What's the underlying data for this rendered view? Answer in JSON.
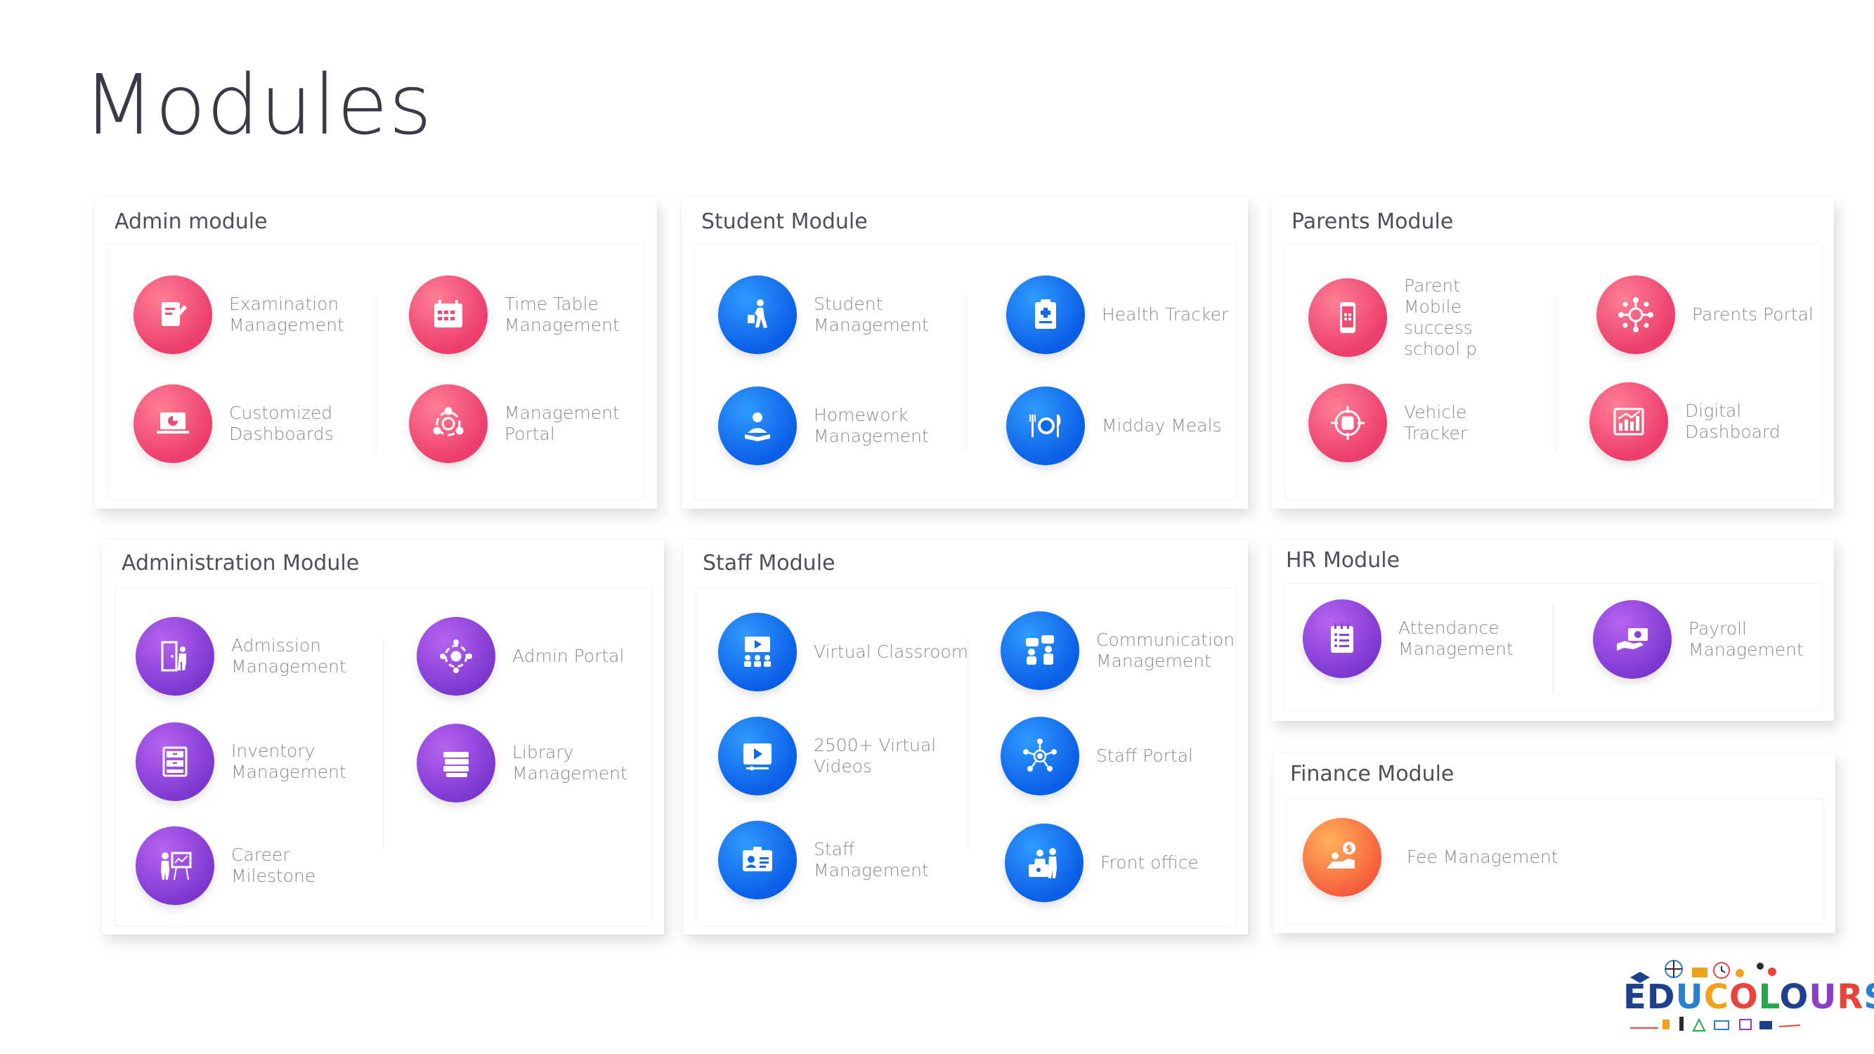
{
  "page": {
    "title": "Modules"
  },
  "modules": {
    "admin": {
      "title": "Admin module",
      "items": [
        {
          "label": "Examination\nManagement",
          "icon": "exam-edit-icon"
        },
        {
          "label": "Time Table\nManagement",
          "icon": "calendar-icon"
        },
        {
          "label": "Customized\nDashboards",
          "icon": "laptop-chart-icon"
        },
        {
          "label": "Management\nPortal",
          "icon": "network-globe-icon"
        }
      ]
    },
    "student": {
      "title": "Student Module",
      "items": [
        {
          "label": "Student\nManagement",
          "icon": "student-walking-icon"
        },
        {
          "label": "Health Tracker",
          "icon": "clipboard-medical-icon"
        },
        {
          "label": "Homework\nManagement",
          "icon": "reading-person-icon"
        },
        {
          "label": "Midday Meals",
          "icon": "plate-cutlery-icon"
        }
      ]
    },
    "parents": {
      "title": "Parents  Module",
      "items": [
        {
          "label": "Parent\nMobile\nsuccess\nschool p",
          "icon": "mobile-phone-icon"
        },
        {
          "label": "Parents Portal",
          "icon": "family-network-icon"
        },
        {
          "label": "Vehicle\nTracker",
          "icon": "bus-target-icon"
        },
        {
          "label": "Digital\nDashboard",
          "icon": "bar-chart-icon"
        }
      ]
    },
    "administration": {
      "title": "Administration Module",
      "items": [
        {
          "label": "Admission\nManagement",
          "icon": "door-entry-icon"
        },
        {
          "label": "Admin Portal",
          "icon": "admin-network-icon"
        },
        {
          "label": "Inventory\nManagement",
          "icon": "cabinet-icon"
        },
        {
          "label": "Library\nManagement",
          "icon": "books-stack-icon"
        },
        {
          "label": "Career\nMilestone",
          "icon": "presentation-icon"
        }
      ]
    },
    "staff": {
      "title": "Staff Module",
      "items": [
        {
          "label": "Virtual Classroom",
          "icon": "video-class-icon"
        },
        {
          "label": "Communication\nManagement",
          "icon": "chat-people-icon"
        },
        {
          "label": "2500+ Virtual\nVideos",
          "icon": "play-screen-icon"
        },
        {
          "label": "Staff Portal",
          "icon": "hub-network-icon"
        },
        {
          "label": "Staff\nManagement",
          "icon": "id-card-icon"
        },
        {
          "label": "Front office",
          "icon": "reception-desk-icon"
        }
      ]
    },
    "hr": {
      "title": "HR Module",
      "items": [
        {
          "label": "Attendance\nManagement",
          "icon": "notepad-list-icon"
        },
        {
          "label": "Payroll\nManagement",
          "icon": "hand-money-icon"
        }
      ]
    },
    "finance": {
      "title": "Finance Module",
      "items": [
        {
          "label": "Fee Management",
          "icon": "fee-coins-icon"
        }
      ]
    }
  },
  "brand": {
    "name": "EDUCOLOURS",
    "letter_colors": [
      "#1f3f8f",
      "#1f3f8f",
      "#2a7fd0",
      "#f0a21b",
      "#e9433a",
      "#27a84a",
      "#1f3f8f",
      "#8b3fc7",
      "#e9433a",
      "#2a7fd0"
    ]
  }
}
